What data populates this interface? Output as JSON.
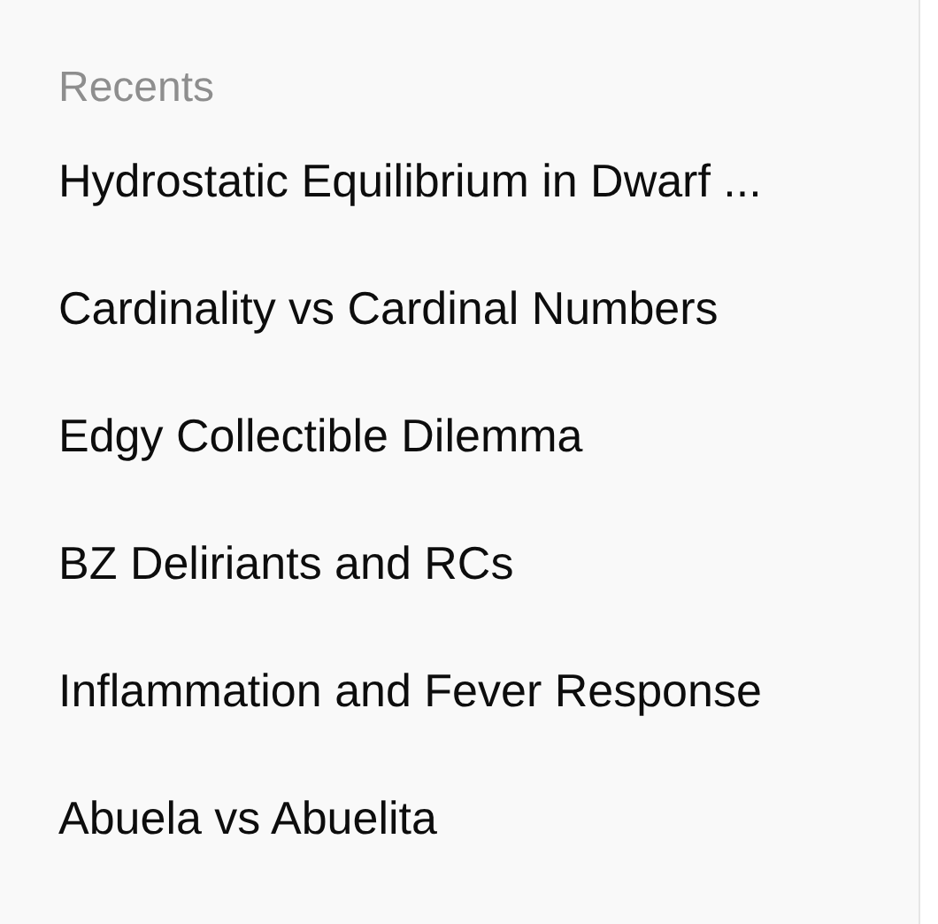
{
  "sidebar": {
    "section_title": "Recents",
    "items": [
      {
        "label": "Hydrostatic Equilibrium in Dwarf ..."
      },
      {
        "label": "Cardinality vs Cardinal Numbers"
      },
      {
        "label": "Edgy Collectible Dilemma"
      },
      {
        "label": "BZ Deliriants and RCs"
      },
      {
        "label": "Inflammation and Fever Response"
      },
      {
        "label": "Abuela vs Abuelita"
      }
    ]
  }
}
